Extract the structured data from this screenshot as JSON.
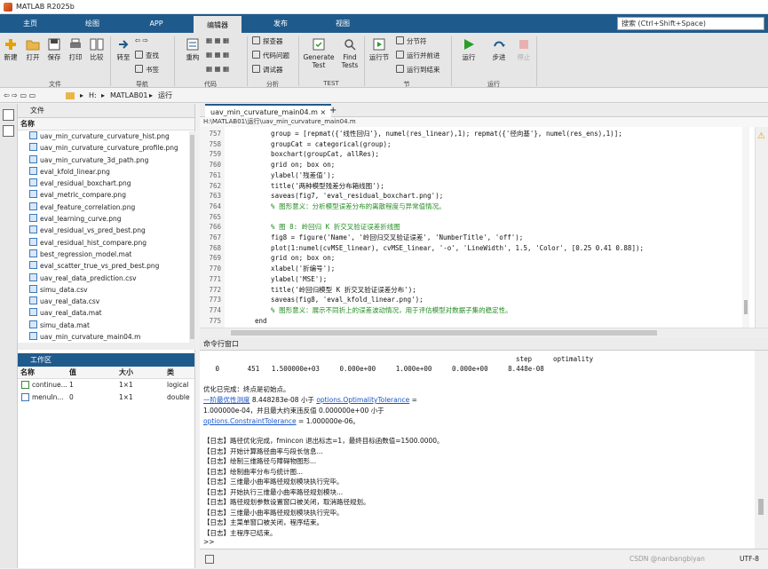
{
  "window": {
    "title": "MATLAB R2025b"
  },
  "tabs": {
    "home": "主页",
    "plots": "绘图",
    "apps": "APP",
    "editor": "编辑器",
    "publish": "发布",
    "view": "视图"
  },
  "search": {
    "placeholder": "搜索 (Ctrl+Shift+Space)"
  },
  "ribbon": {
    "new": "新建",
    "open": "打开",
    "save": "保存",
    "print": "打印",
    "compare": "比较",
    "grp_file": "文件",
    "goto": "转至",
    "find": "查找",
    "bookmark": "书签",
    "grp_nav": "导航",
    "refactor": "重构",
    "grp_code": "代码",
    "profiler": "探查器",
    "analyze": "代码问题",
    "debugger": "调试器",
    "grp_analyze": "分析",
    "gen_test_a": "Generate",
    "gen_test_b": "Test",
    "find_tests_a": "Find",
    "find_tests_b": "Tests",
    "grp_test": "TEST",
    "run_section": "运行节",
    "section_break": "分节符",
    "run_advance": "运行并前进",
    "run_to_end": "运行到结束",
    "grp_section": "节",
    "run": "运行",
    "step": "步进",
    "stop": "停止",
    "grp_run": "运行"
  },
  "address": {
    "drive": "H:",
    "folder": "MATLAB01",
    "sub": "运行"
  },
  "files": {
    "title": "文件",
    "col_name": "名称",
    "items": [
      "uav_min_curvature_curvature_hist.png",
      "uav_min_curvature_curvature_profile.png",
      "uav_min_curvature_3d_path.png",
      "eval_kfold_linear.png",
      "eval_residual_boxchart.png",
      "eval_metric_compare.png",
      "eval_feature_correlation.png",
      "eval_learning_curve.png",
      "eval_residual_vs_pred_best.png",
      "eval_residual_hist_compare.png",
      "best_regression_model.mat",
      "eval_scatter_true_vs_pred_best.png",
      "uav_real_data_prediction.csv",
      "simu_data.csv",
      "uav_real_data.csv",
      "uav_real_data.mat",
      "simu_data.mat",
      "uav_min_curvature_main04.m"
    ]
  },
  "workspace": {
    "title": "工作区",
    "col_name": "名称",
    "col_value": "值",
    "col_size": "大小",
    "col_class": "类",
    "rows": [
      {
        "name": "continue...",
        "value": "1",
        "size": "1×1",
        "class": "logical"
      },
      {
        "name": "menuIn...",
        "value": "0",
        "size": "1×1",
        "class": "double"
      }
    ]
  },
  "editor": {
    "tab": "uav_min_curvature_main04.m",
    "add": "+",
    "path": "H:\\MATLAB01\\运行\\uav_min_curvature_main04.m",
    "lines": [
      {
        "n": "757",
        "t": "    group = [repmat({'线性回归'}, numel(res_linear),1); repmat({'径向基'}, numel(res_ens),1)];",
        "c": false
      },
      {
        "n": "758",
        "t": "    groupCat = categorical(group);",
        "c": false
      },
      {
        "n": "759",
        "t": "    boxchart(groupCat, allRes);",
        "c": false
      },
      {
        "n": "760",
        "t": "    grid on; box on;",
        "c": false
      },
      {
        "n": "761",
        "t": "    ylabel('残差值');",
        "c": false
      },
      {
        "n": "762",
        "t": "    title('两种模型残差分布箱线图');",
        "c": false
      },
      {
        "n": "763",
        "t": "    saveas(fig7, 'eval_residual_boxchart.png');",
        "c": false
      },
      {
        "n": "764",
        "t": "    % 图形意义：分析模型误差分布的离散程度与异常值情况。",
        "c": true
      },
      {
        "n": "765",
        "t": "",
        "c": false
      },
      {
        "n": "766",
        "t": "    % 图 8: 岭回归 K 折交叉验证误差折线图",
        "c": true
      },
      {
        "n": "767",
        "t": "    fig8 = figure('Name', '岭回归交叉验证误差', 'NumberTitle', 'off');",
        "c": false
      },
      {
        "n": "768",
        "t": "    plot(1:numel(cvMSE_linear), cvMSE_linear, '-o', 'LineWidth', 1.5, 'Color', [0.25 0.41 0.88]);",
        "c": false
      },
      {
        "n": "769",
        "t": "    grid on; box on;",
        "c": false
      },
      {
        "n": "770",
        "t": "    xlabel('折编号');",
        "c": false
      },
      {
        "n": "771",
        "t": "    ylabel('MSE');",
        "c": false
      },
      {
        "n": "772",
        "t": "    title('岭回归模型 K 折交叉验证误差分布');",
        "c": false
      },
      {
        "n": "773",
        "t": "    saveas(fig8, 'eval_kfold_linear.png');",
        "c": false
      },
      {
        "n": "774",
        "t": "    % 图形意义：展示不同折上的误差波动情况，用于评估模型对数据子集的稳定性。",
        "c": true
      },
      {
        "n": "775",
        "t": "end",
        "c": false
      },
      {
        "n": "776",
        "t": "",
        "c": false
      }
    ]
  },
  "command": {
    "title": "命令行窗口",
    "hdr_step": "step",
    "hdr_opt": "optimality",
    "row": "   0       451   1.500000e+03     0.000e+00     1.000e+00     0.000e+00     8.448e-08",
    "done": "优化已完成：终点是初始点。",
    "l1a": "一阶最优性测度",
    "l1b": " 8.448283e-08 小于 ",
    "l1c": "options.OptimalityTolerance",
    "l1d": " =",
    "l2": "1.000000e-04，并且最大约束违反值 0.000000e+00 小于",
    "l3a": "options.ConstraintTolerance",
    "l3b": " = 1.000000e-06。",
    "logs": [
      "【日志】路径优化完成，fmincon 退出标志=1，最终目标函数值=1500.0000。",
      "【日志】开始计算路径曲率与段长信息...",
      "【日志】绘制三维路径与障碍物图形...",
      "【日志】绘制曲率分布与统计图...",
      "【日志】三维最小曲率路径规划模块执行完毕。",
      "【日志】开始执行三维最小曲率路径规划模块...",
      "【日志】路径规划参数设置窗口被关闭，取消路径规划。",
      "【日志】三维最小曲率路径规划模块执行完毕。",
      "【日志】主菜单窗口被关闭，程序结束。",
      "【日志】主程序已结束。"
    ],
    "prompt": ">>"
  },
  "status": {
    "left": "",
    "enc": "UTF-8",
    "pos": "CSDN @nanbangbiyan"
  },
  "colors": {
    "accent": "#1f5a8c",
    "comment": "#228b22",
    "link": "#1a55c8"
  }
}
